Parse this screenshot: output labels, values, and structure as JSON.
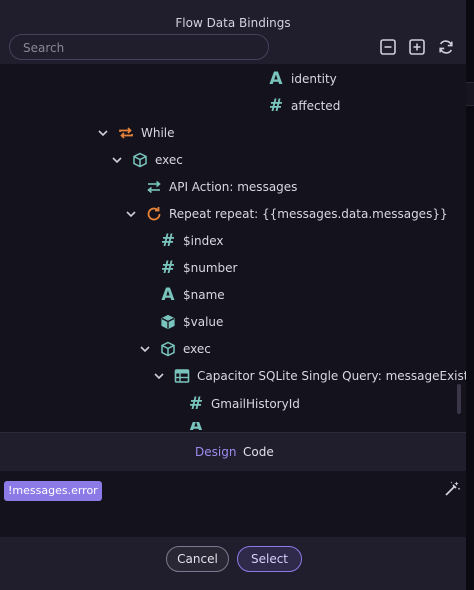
{
  "dialog": {
    "title": "Flow Data Bindings"
  },
  "search": {
    "placeholder": "Search",
    "value": ""
  },
  "toolbar": {
    "collapse_icon": "minus-square-icon",
    "expand_icon": "plus-square-icon",
    "refresh_icon": "refresh-icon"
  },
  "tree": {
    "items": [
      {
        "label": "identity",
        "icon": "text-type-icon"
      },
      {
        "label": "affected",
        "icon": "number-type-icon"
      },
      {
        "label": "While",
        "icon": "loop-icon",
        "expanded": true
      },
      {
        "label": "exec",
        "icon": "cube-icon",
        "expanded": true
      },
      {
        "label": "API Action: messages",
        "icon": "swap-icon"
      },
      {
        "label": "Repeat repeat: {{messages.data.messages}}",
        "icon": "repeat-icon",
        "expanded": true
      },
      {
        "label": "$index",
        "icon": "number-type-icon"
      },
      {
        "label": "$number",
        "icon": "number-type-icon"
      },
      {
        "label": "$name",
        "icon": "text-type-icon"
      },
      {
        "label": "$value",
        "icon": "cube-icon"
      },
      {
        "label": "exec",
        "icon": "cube-icon",
        "expanded": true
      },
      {
        "label": "Capacitor SQLite Single Query: messageExists_SQLi",
        "icon": "table-icon",
        "expanded": true
      },
      {
        "label": "GmailHistoryId",
        "icon": "number-type-icon"
      }
    ]
  },
  "tabs": [
    {
      "label": "Design",
      "active": true
    },
    {
      "label": "Code",
      "active": false
    }
  ],
  "editor": {
    "chip_text": "!messages.error",
    "wand_icon": "magic-wand-icon"
  },
  "footer": {
    "cancel_label": "Cancel",
    "select_label": "Select"
  },
  "colors": {
    "accent": "#8c7ae6",
    "teal": "#7ac4be",
    "orange": "#e8843a",
    "panel": "#201d2c",
    "tree_bg": "#14121c"
  }
}
